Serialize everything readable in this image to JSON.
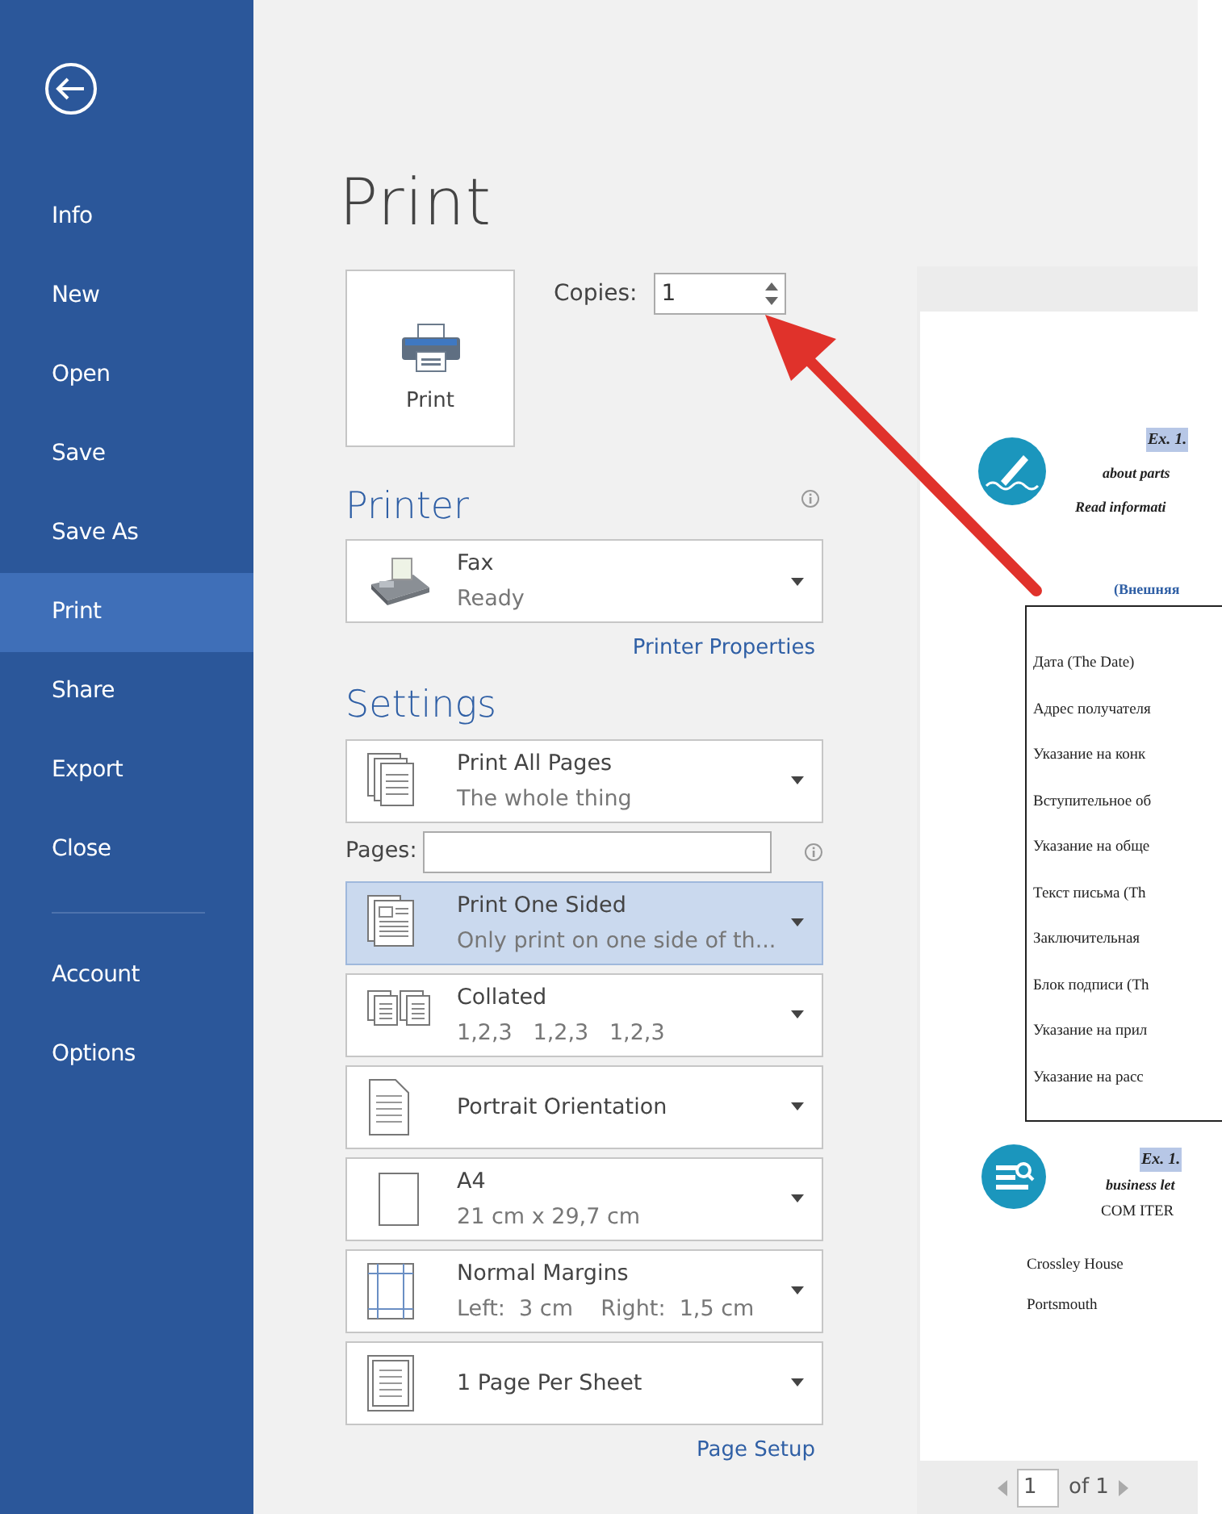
{
  "sidebar": {
    "items": [
      {
        "label": "Info",
        "selected": false
      },
      {
        "label": "New",
        "selected": false
      },
      {
        "label": "Open",
        "selected": false
      },
      {
        "label": "Save",
        "selected": false
      },
      {
        "label": "Save As",
        "selected": false
      },
      {
        "label": "Print",
        "selected": true
      },
      {
        "label": "Share",
        "selected": false
      },
      {
        "label": "Export",
        "selected": false
      },
      {
        "label": "Close",
        "selected": false
      }
    ],
    "footer_items": [
      {
        "label": "Account",
        "selected": false
      },
      {
        "label": "Options",
        "selected": false
      }
    ]
  },
  "title": "Print",
  "print_button": {
    "label": "Print"
  },
  "copies": {
    "label": "Copies:",
    "value": "1"
  },
  "printer": {
    "heading": "Printer",
    "name": "Fax",
    "status": "Ready",
    "properties_link": "Printer Properties"
  },
  "settings": {
    "heading": "Settings",
    "items": [
      {
        "kind": "dropdown",
        "title": "Print All Pages",
        "subtitle": "The whole thing",
        "selected": false
      },
      {
        "kind": "pages",
        "label": "Pages:"
      },
      {
        "kind": "dropdown",
        "title": "Print One Sided",
        "subtitle": "Only print on one side of th...",
        "selected": true
      },
      {
        "kind": "dropdown",
        "title": "Collated",
        "subtitle": "1,2,3   1,2,3   1,2,3",
        "selected": false
      },
      {
        "kind": "dropdown",
        "title": "Portrait Orientation",
        "selected": false
      },
      {
        "kind": "dropdown",
        "title": "A4",
        "subtitle": "21 cm x 29,7 cm",
        "selected": false
      },
      {
        "kind": "dropdown",
        "title": "Normal Margins",
        "subtitle": "Left:  3 cm    Right:  1,5 cm",
        "selected": false
      },
      {
        "kind": "dropdown",
        "title": "1 Page Per Sheet",
        "selected": false
      }
    ],
    "page_setup_link": "Page Setup"
  },
  "preview": {
    "document": {
      "exercise1": {
        "heading": "Ex. 1.",
        "lines": [
          "about parts",
          "Read informati"
        ]
      },
      "subtitle": "(Внешняя",
      "table_rows": [
        "Дата (The Date)",
        "Адрес получателя",
        "Указание на конк",
        "Вступительное об",
        "Указание на обще",
        "Текст письма (Th",
        "Заключительная",
        "Блок подписи (Th",
        "Указание на прил",
        "Указание на расс"
      ],
      "exercise2": {
        "heading": "Ex. 1.",
        "lines": [
          "business let",
          "COM ITER"
        ]
      },
      "address": [
        "Crossley House",
        "Portsmouth"
      ]
    },
    "page_nav": {
      "page": "1",
      "of": "of 1"
    }
  }
}
